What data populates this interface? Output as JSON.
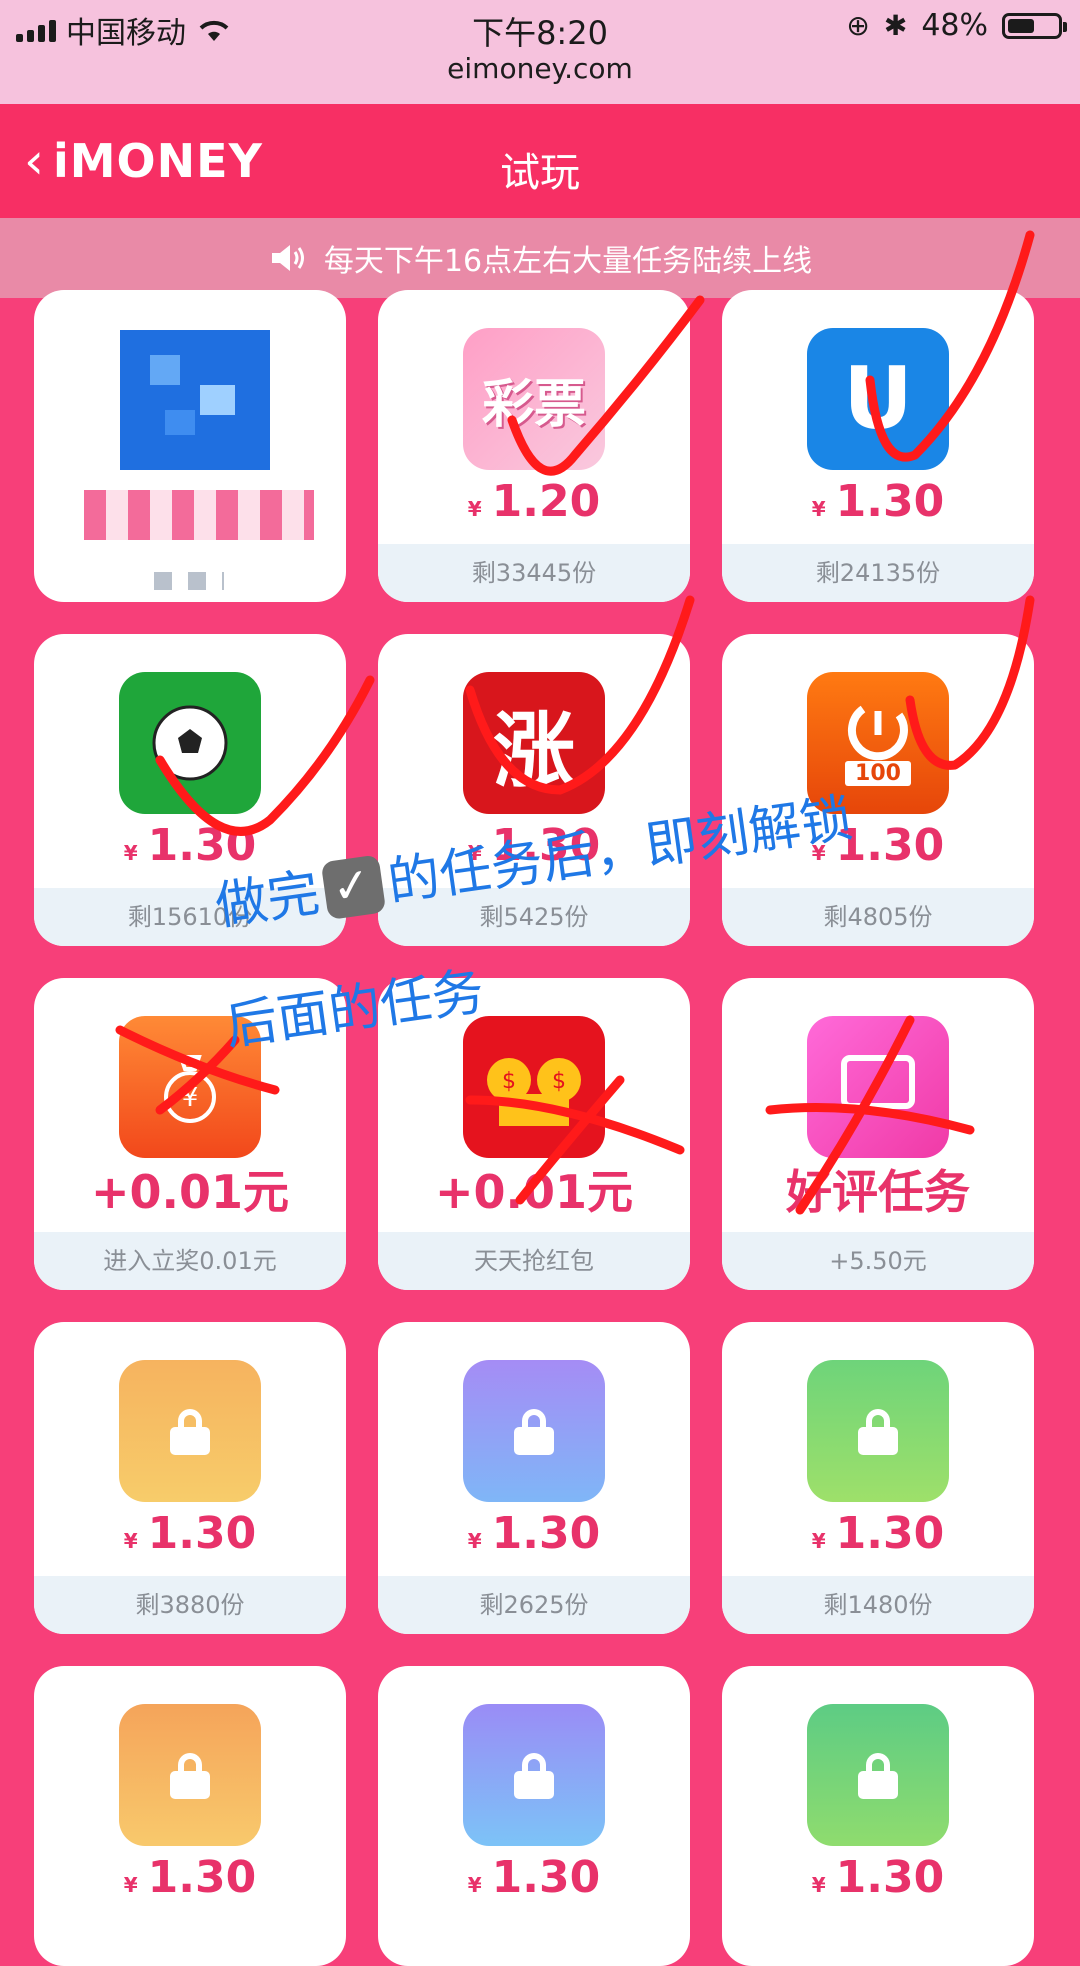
{
  "status": {
    "carrier": "中国移动",
    "time": "下午8:20",
    "battery": "48%",
    "battery_level": 0.48,
    "url": "eimoney.com"
  },
  "nav": {
    "brand": "iMONEY",
    "title": "试玩"
  },
  "notice": {
    "icon": "speaker-icon",
    "text": "每天下午16点左右大量任务陆续上线"
  },
  "cards": [
    {
      "icon": "blurred-app-icon",
      "price": "",
      "footer": ""
    },
    {
      "icon": "lottery-app-icon",
      "icon_text": "彩票",
      "price": "1.20",
      "footer": "剩33445份"
    },
    {
      "icon": "u-app-icon",
      "icon_text": "U",
      "price": "1.30",
      "footer": "剩24135份"
    },
    {
      "icon": "soccer-app-icon",
      "price": "1.30",
      "footer": "剩15610份"
    },
    {
      "icon": "zhang-app-icon",
      "icon_text": "涨",
      "price": "1.30",
      "footer": "剩5425份"
    },
    {
      "icon": "clock-100-app-icon",
      "icon_text": "100",
      "price": "1.30",
      "footer": "剩4805份"
    },
    {
      "icon": "money-bag-icon",
      "promo": "+0.01元",
      "footer": "进入立奖0.01元"
    },
    {
      "icon": "red-envelope-icon",
      "promo": "+0.01元",
      "footer": "天天抢红包"
    },
    {
      "icon": "review-icon",
      "promo": "好评任务",
      "footer": "+5.50元"
    },
    {
      "icon": "lock-icon",
      "price": "1.30",
      "footer": "剩3880份"
    },
    {
      "icon": "lock-icon",
      "price": "1.30",
      "footer": "剩2625份"
    },
    {
      "icon": "lock-icon",
      "price": "1.30",
      "footer": "剩1480份"
    },
    {
      "icon": "lock-icon",
      "price": "1.30",
      "footer": ""
    },
    {
      "icon": "lock-icon",
      "price": "1.30",
      "footer": ""
    },
    {
      "icon": "lock-icon",
      "price": "1.30",
      "footer": ""
    }
  ],
  "currency": "¥",
  "annotation": {
    "line1_a": "做完",
    "line1_b": "的任务后，即刻解锁",
    "line2": "后面的任务"
  },
  "colors": {
    "page_bg": "#f73f79",
    "nav_bg": "#f72f64",
    "price": "#e8326a",
    "annotation_ink": "#ff1a1a",
    "annotation_text": "#1f78e6"
  }
}
